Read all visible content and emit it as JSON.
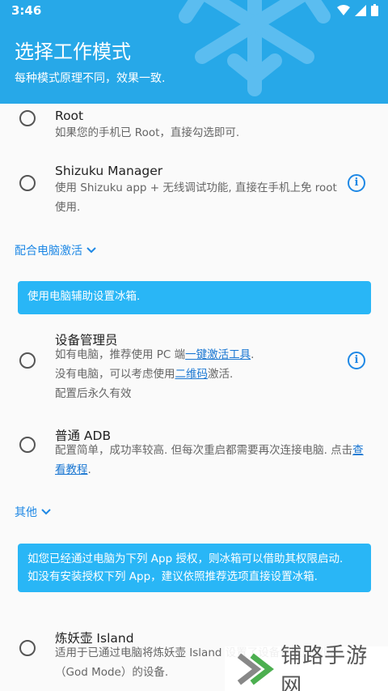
{
  "status": {
    "time": "3:46"
  },
  "header": {
    "title": "选择工作模式",
    "subtitle": "每种模式原理不同，效果一致."
  },
  "options": {
    "root": {
      "title": "Root",
      "desc": "如果您的手机已 Root，直接勾选即可."
    },
    "shizuku": {
      "title": "Shizuku Manager",
      "desc": "使用 Shizuku app + 无线调试功能, 直接在手机上免 root 使用."
    },
    "device_admin": {
      "title": "设备管理员",
      "line1_prefix": "如有电脑，推荐使用 PC 端",
      "line1_link": "一键激活工具",
      "line1_suffix": ".",
      "line2_prefix": "没有电脑，可以考虑使用",
      "line2_link": "二维码",
      "line2_suffix": "激活.",
      "line3": "配置后永久有效"
    },
    "adb": {
      "title": "普通 ADB",
      "desc_prefix": "配置简单，成功率较高. 但每次重启都需要再次连接电脑. 点击",
      "desc_link": "查看教程",
      "desc_suffix": "."
    },
    "island": {
      "title": "炼妖壶 Island",
      "desc": "适用于已通过电脑将炼妖壶 Island 设置了设备管理员权限（God Mode）的设备."
    }
  },
  "sections": {
    "pc_activation": "配合电脑激活",
    "other": "其他"
  },
  "banners": {
    "pc_assist": "使用电脑辅助设置冰箱.",
    "other_line1": "如您已经通过电脑为下列 App 授权，则冰箱可以借助其权限启动.",
    "other_line2": "如没有安装授权下列 App，建议依照推荐选项直接设置冰箱."
  },
  "watermark": {
    "text": "铺路手游网"
  },
  "colors": {
    "primary": "#27a8e8",
    "banner": "#29b6f6",
    "link": "#1e88e5"
  }
}
